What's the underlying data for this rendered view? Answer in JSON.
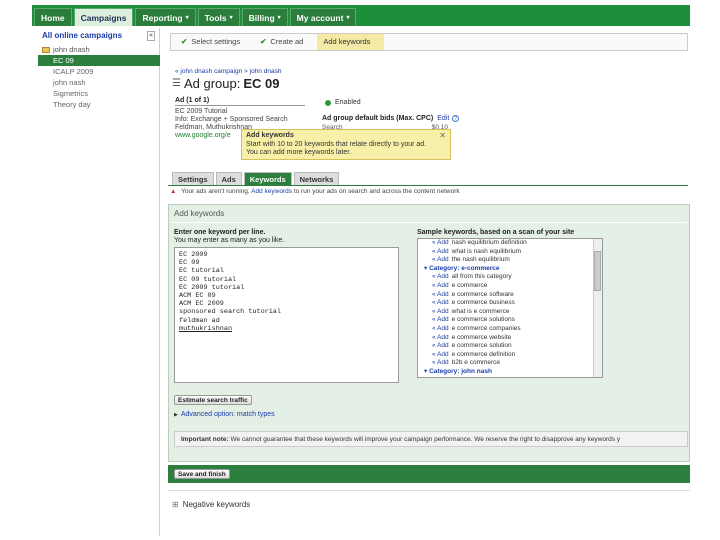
{
  "topnav": {
    "tabs": [
      {
        "label": "Home",
        "arrow": ""
      },
      {
        "label": "Campaigns",
        "arrow": ""
      },
      {
        "label": "Reporting",
        "arrow": "▾"
      },
      {
        "label": "Tools",
        "arrow": "▾"
      },
      {
        "label": "Billing",
        "arrow": "▾"
      },
      {
        "label": "My account",
        "arrow": "▾"
      }
    ]
  },
  "sidebar": {
    "header": "All online campaigns",
    "collapse": "«",
    "campaign": "john dnash",
    "items": [
      "EC 09",
      "ICALP 2009",
      "john nash",
      "Sigmetrics",
      "Theory day"
    ]
  },
  "steps": [
    "Select settings",
    "Create ad",
    "Add keywords"
  ],
  "breadcrumb": "« john dnash campaign > john dnash",
  "adgroup": {
    "prefix": "Ad group:",
    "name": "EC 09",
    "status": "Enabled",
    "ad_label": "Ad (1 of 1)",
    "ad_lines": [
      "EC 2009 Tutorial",
      "Info: Exchange + Sponsored Search",
      "Feldman, Muthukrishnan"
    ],
    "ad_url": "www.google.org/e",
    "bids_label": "Ad group default bids (Max. CPC)",
    "edit": "Edit",
    "bid_row_label": "Search",
    "bid_row_value": "$0.10"
  },
  "tooltip": {
    "title": "Add keywords",
    "line1": "Start with 10 to 20 keywords that relate directly to your ad.",
    "line2": "You can add more keywords later."
  },
  "content_tabs": [
    "Settings",
    "Ads",
    "Keywords",
    "Networks"
  ],
  "warning": {
    "text1": "Your ads aren't running.",
    "link": "Add keywords",
    "text2": "to run your ads on search and across the content network"
  },
  "panel": {
    "title": "Add keywords",
    "enter_title": "Enter one keyword per line.",
    "enter_sub": "You may enter as many as you like.",
    "keywords": [
      "EC 2009",
      "EC 09",
      "EC tutorial",
      "EC 09 tutorial",
      "EC 2009 tutorial",
      "ACM EC 09",
      "ACM EC 2009",
      "sponsored search tutorial",
      "feldman ad",
      "muthukrishnan"
    ],
    "sample_title": "Sample keywords, based on a scan of your site",
    "sample_rows": [
      {
        "kind": "kw",
        "add": "« Add",
        "text": "nash equilibrium definition"
      },
      {
        "kind": "kw",
        "add": "« Add",
        "text": "what is nash equilibrium"
      },
      {
        "kind": "kw",
        "add": "« Add",
        "text": "the nash equilibrium"
      },
      {
        "kind": "cat",
        "add": "",
        "text": "Category: e-commerce"
      },
      {
        "kind": "kw",
        "add": "« Add",
        "text": "all from this category"
      },
      {
        "kind": "kw",
        "add": "« Add",
        "text": "e commerce"
      },
      {
        "kind": "kw",
        "add": "« Add",
        "text": "e commerce software"
      },
      {
        "kind": "kw",
        "add": "« Add",
        "text": "e commerce business"
      },
      {
        "kind": "kw",
        "add": "« Add",
        "text": "what is e commerce"
      },
      {
        "kind": "kw",
        "add": "« Add",
        "text": "e commerce solutions"
      },
      {
        "kind": "kw",
        "add": "« Add",
        "text": "e commerce companies"
      },
      {
        "kind": "kw",
        "add": "« Add",
        "text": "e commerce website"
      },
      {
        "kind": "kw",
        "add": "« Add",
        "text": "e commerce solution"
      },
      {
        "kind": "kw",
        "add": "« Add",
        "text": "e commerce definition"
      },
      {
        "kind": "kw",
        "add": "« Add",
        "text": "b2b e commerce"
      },
      {
        "kind": "cat",
        "add": "",
        "text": "Category: john nash"
      }
    ],
    "estimate_button": "Estimate search traffic",
    "advanced": "Advanced option: match types",
    "note_bold": "Important note:",
    "note_text": "We cannot guarantee that these keywords will improve your campaign performance. We reserve the right to disapprove any keywords y"
  },
  "save_button": "Save and finish",
  "negative": "Negative keywords",
  "colors": {
    "topbar": "#1d8f3a",
    "accent": "#2d7f3e",
    "panel": "#e4efe6",
    "tooltip": "#f8efa8"
  }
}
